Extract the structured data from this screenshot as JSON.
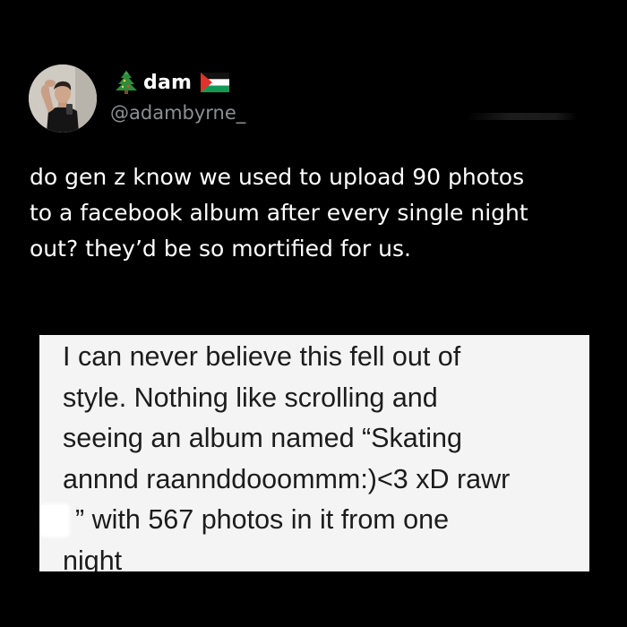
{
  "author": {
    "display_name": "dam",
    "handle": "@adambyrne_",
    "avatar": "avatar",
    "name_prefix_icon": "christmas-tree-icon",
    "name_suffix_icon": "palestine-flag-icon"
  },
  "tweet": {
    "lines": [
      "do gen z know we used to upload 90 photos",
      "to a facebook album after every single night",
      "out? they’d be so mortified for us."
    ]
  },
  "quoted": {
    "lines": [
      "I can never believe this fell out of",
      "style. Nothing like scrolling and",
      "seeing an album named “Skating",
      "annnd raannddooommm:)<3 xD rawr",
      "” with 567 photos in it from one",
      "night"
    ]
  },
  "colors": {
    "background": "#000000",
    "text": "#ffffff",
    "handle": "#8b8f93",
    "quoted_bg": "#f4f4f4",
    "quoted_text": "#1c1c1c",
    "flag_green": "#149954",
    "flag_red": "#e4312b"
  }
}
